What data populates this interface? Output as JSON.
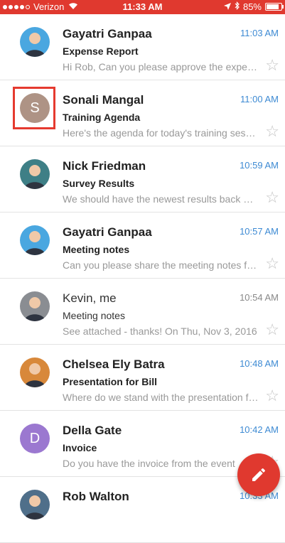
{
  "status_bar": {
    "carrier": "Verizon",
    "time": "11:33 AM",
    "battery_percent": "85%",
    "battery_level": 0.85,
    "signal_bars": 4,
    "icons": [
      "signal-dots-icon",
      "wifi-icon",
      "location-arrow-icon",
      "bluetooth-icon",
      "battery-icon"
    ],
    "color": "#e0392f"
  },
  "emails": [
    {
      "sender": "Gayatri Ganpaa",
      "time": "11:03 AM",
      "subject": "Expense Report",
      "snippet": "Hi Rob, Can you please approve the expense report",
      "unread": true,
      "avatar": "photo",
      "avatar_color": "#4aa7e0"
    },
    {
      "sender": "Sonali Mangal",
      "time": "11:00 AM",
      "subject": "Training Agenda",
      "snippet": "Here's the agenda for today's training session",
      "unread": true,
      "avatar": "letter",
      "avatar_letter": "S",
      "avatar_color": "#ae9385",
      "highlighted": true
    },
    {
      "sender": "Nick Friedman",
      "time": "10:59 AM",
      "subject": "Survey Results",
      "snippet": "We should have the newest results back by tomorrow",
      "unread": true,
      "avatar": "photo",
      "avatar_color": "#3e7f86"
    },
    {
      "sender": "Gayatri Ganpaa",
      "time": "10:57 AM",
      "subject": "Meeting notes",
      "snippet": "Can you please share the meeting notes from today",
      "unread": true,
      "avatar": "photo",
      "avatar_color": "#4aa7e0"
    },
    {
      "sender": "Kevin, me",
      "time": "10:54 AM",
      "subject": "Meeting notes",
      "snippet": "See attached - thanks! On Thu, Nov 3, 2016",
      "unread": false,
      "avatar": "photo",
      "avatar_color": "#8a8d92"
    },
    {
      "sender": "Chelsea Ely Batra",
      "time": "10:48 AM",
      "subject": "Presentation for Bill",
      "snippet": "Where do we stand with the presentation for Bill",
      "unread": true,
      "avatar": "photo",
      "avatar_color": "#d8883a"
    },
    {
      "sender": "Della Gate",
      "time": "10:42 AM",
      "subject": "Invoice",
      "snippet": "Do you have the invoice from the event",
      "unread": true,
      "avatar": "letter",
      "avatar_letter": "D",
      "avatar_color": "#9b78d0"
    },
    {
      "sender": "Rob Walton",
      "time": "10:33 AM",
      "subject": "",
      "snippet": "",
      "unread": true,
      "avatar": "photo",
      "avatar_color": "#4f6f8a"
    }
  ],
  "compose_button": {
    "icon": "pencil-icon",
    "color": "#e0392f"
  }
}
